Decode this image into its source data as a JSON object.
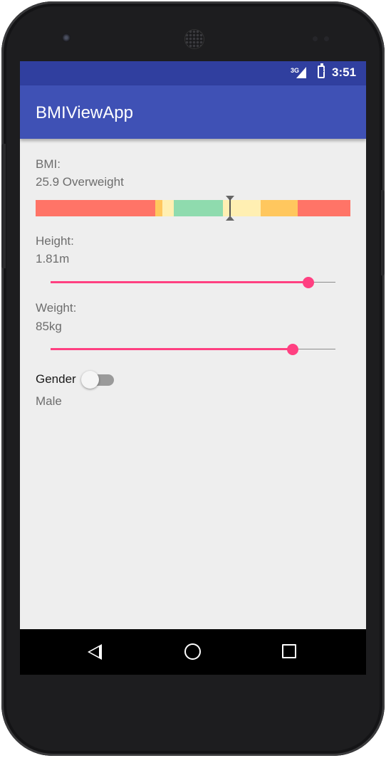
{
  "status_bar": {
    "network": "3G",
    "time": "3:51",
    "icons": [
      "signal-icon",
      "battery-charging-icon"
    ]
  },
  "app_bar": {
    "title": "BMIViewApp"
  },
  "bmi": {
    "label": "BMI:",
    "value_text": "25.9 Overweight",
    "marker_value": 25.9,
    "scale_segment_colors": [
      "#ff7467",
      "#ffc75e",
      "#ffefb2",
      "#8fdbae",
      "#ffefb2",
      "#ffc75e",
      "#ff7467"
    ]
  },
  "height": {
    "label": "Height:",
    "value_text": "1.81m",
    "slider_fraction": 0.905
  },
  "weight": {
    "label": "Weight:",
    "value_text": "85kg",
    "slider_fraction": 0.85
  },
  "gender": {
    "label": "Gender",
    "value_text": "Male",
    "switch_on": false
  },
  "navigation": {
    "icons": [
      "back-icon",
      "home-icon",
      "recent-apps-icon"
    ]
  },
  "colors": {
    "primary": "#3f51b5",
    "primary_dark": "#303f9f",
    "accent": "#ff4081",
    "background": "#eeeeee"
  }
}
